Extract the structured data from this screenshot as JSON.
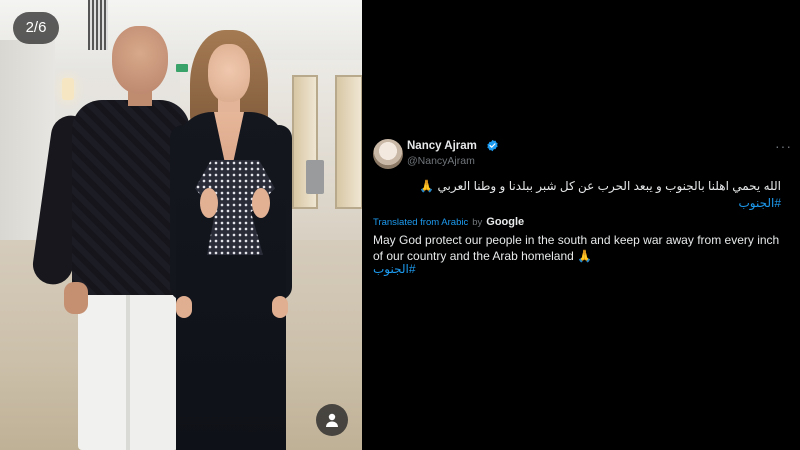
{
  "gallery": {
    "counter": "2/6",
    "profile_icon": "person-icon"
  },
  "tweet": {
    "author_name": "Nancy Ajram",
    "handle": "@NancyAjram",
    "verified_icon": "verified-badge-icon",
    "more_icon": "more-options-icon",
    "more_glyph": "···",
    "original_text": "الله يحمي اهلنا بالجنوب و يبعد الحرب عن كل شبر ببلدنا و وطنا العربي 🙏",
    "original_hashtag": "#الجنوب",
    "translated_from": "Translated from Arabic",
    "translated_by": "by",
    "translator": "Google",
    "translation_text": "May God protect our people in the south and keep war away from every inch of our country and the Arab homeland 🙏",
    "translation_hashtag": "#الجنوب"
  },
  "colors": {
    "background": "#000000",
    "text": "#e7e9ea",
    "muted": "#71767b",
    "link": "#1d9bf0"
  }
}
